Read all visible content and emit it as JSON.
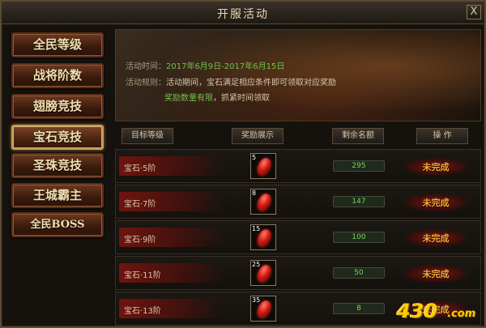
{
  "window": {
    "title": "开服活动",
    "close_label": "X"
  },
  "sidebar": {
    "items": [
      {
        "label": "全民等级",
        "active": false
      },
      {
        "label": "战将阶数",
        "active": false
      },
      {
        "label": "翅膀竞技",
        "active": false
      },
      {
        "label": "宝石竞技",
        "active": true
      },
      {
        "label": "圣珠竞技",
        "active": false
      },
      {
        "label": "王城霸主",
        "active": false
      },
      {
        "label": "全民BOSS",
        "active": false
      }
    ]
  },
  "banner": {
    "time_label": "活动时间：",
    "time_value": "2017年6月9日-2017年6月15日",
    "rule_label": "活动规则：",
    "rule_value": "活动期间，宝石满足相应条件即可领取对应奖励",
    "limit_value": "奖励数量有限",
    "limit_rest": "，抓紧时间领取"
  },
  "table": {
    "headers": [
      "目标等级",
      "奖励展示",
      "剩余名额",
      "操    作"
    ],
    "rows": [
      {
        "name": "宝石·5阶",
        "reward_count": "5",
        "remaining": "295",
        "status": "未完成"
      },
      {
        "name": "宝石·7阶",
        "reward_count": "8",
        "remaining": "147",
        "status": "未完成"
      },
      {
        "name": "宝石·9阶",
        "reward_count": "15",
        "remaining": "100",
        "status": "未完成"
      },
      {
        "name": "宝石·11阶",
        "reward_count": "25",
        "remaining": "50",
        "status": "未完成"
      },
      {
        "name": "宝石·13阶",
        "reward_count": "35",
        "remaining": "8",
        "status": "未完成"
      }
    ]
  },
  "watermark": {
    "number": "430",
    "domain": ".com"
  },
  "colors": {
    "accent_green": "#6fc24a",
    "status_orange": "#f3a93a",
    "gem_red": "#d21a12"
  },
  "icons": {
    "reward": "red-gem-icon",
    "close": "close-icon"
  }
}
